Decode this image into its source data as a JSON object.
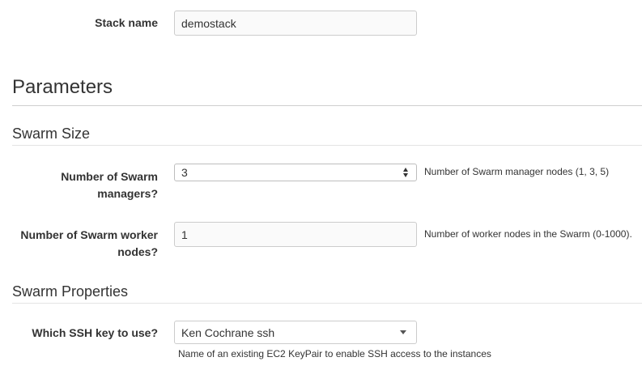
{
  "stack": {
    "label": "Stack name",
    "value": "demostack"
  },
  "parameters": {
    "heading": "Parameters"
  },
  "swarm_size": {
    "heading": "Swarm Size",
    "managers": {
      "label_line1": "Number of Swarm",
      "label_line2": "managers?",
      "value": "3",
      "help": "Number of Swarm manager nodes (1, 3, 5)"
    },
    "workers": {
      "label_line1": "Number of Swarm worker",
      "label_line2": "nodes?",
      "value": "1",
      "help": "Number of worker nodes in the Swarm (0-1000)."
    }
  },
  "swarm_properties": {
    "heading": "Swarm Properties",
    "ssh_key": {
      "label": "Which SSH key to use?",
      "value": "Ken Cochrane ssh",
      "help": "Name of an existing EC2 KeyPair to enable SSH access to the instances"
    }
  }
}
